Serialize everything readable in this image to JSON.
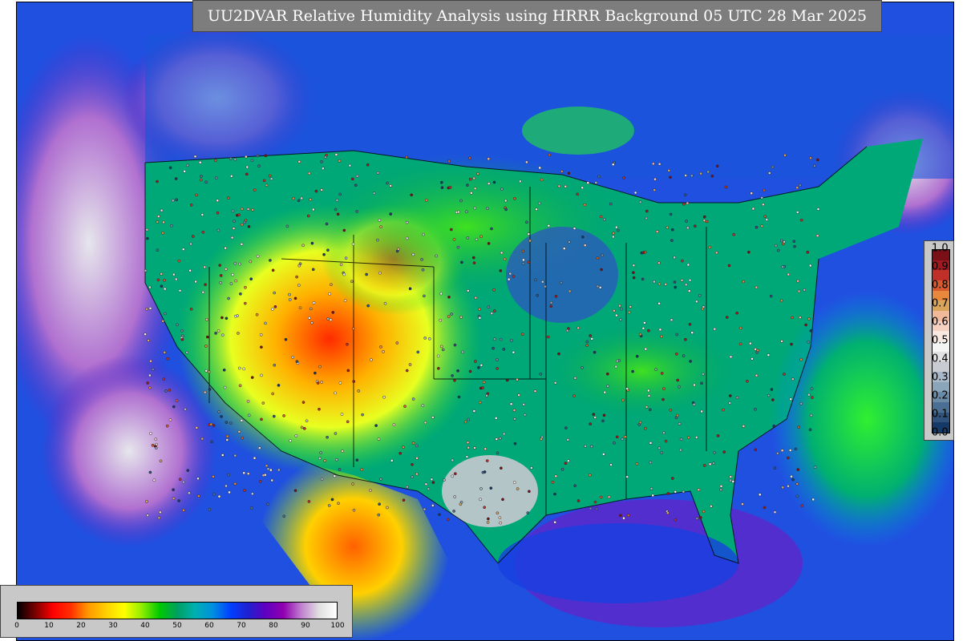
{
  "title": "UU2DVAR Relative Humidity Analysis using HRRR Background 05 UTC 28 Mar 2025",
  "rh_legend": {
    "ticks": [
      "0",
      "10",
      "20",
      "30",
      "40",
      "50",
      "60",
      "70",
      "80",
      "90",
      "100"
    ],
    "stops": [
      "#000000",
      "#7a0000",
      "#ff0000",
      "#ff3000",
      "#ff9a00",
      "#ffd000",
      "#ffff00",
      "#90ee00",
      "#00c800",
      "#00a060",
      "#00b0b0",
      "#0090e0",
      "#0040ff",
      "#2020d0",
      "#6000c0",
      "#9000b0",
      "#c080d0",
      "#e0e0e0",
      "#ffffff"
    ]
  },
  "obs_legend": {
    "ticks": [
      "1.0",
      "0.9",
      "0.8",
      "0.7",
      "0.6",
      "0.5",
      "0.4",
      "0.3",
      "0.2",
      "0.1",
      "0.0"
    ],
    "colors": [
      "#7a0f17",
      "#a01820",
      "#c03028",
      "#d85a2c",
      "#e8883c",
      "#d9a55a",
      "#f2b89a",
      "#f6d0c0",
      "#f8e8e0",
      "#f4f4f4",
      "#e2e2e4",
      "#c8ccd2",
      "#a8b8c8",
      "#8aa4ba",
      "#6a8aa8",
      "#4a6e94",
      "#2e527c",
      "#163a68"
    ]
  }
}
